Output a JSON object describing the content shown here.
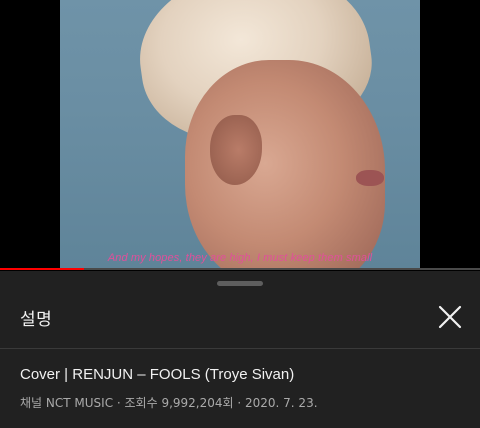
{
  "video": {
    "subtitle": "And my hopes, they are high, I must keep them small",
    "progress": 0.175,
    "progress_color": "#ff0000"
  },
  "sheet": {
    "title": "설명",
    "close_icon": "close-icon",
    "video_title": "Cover | RENJUN – FOOLS (Troye Sivan)",
    "meta": "채널 NCT MUSIC · 조회수 9,992,204회 · 2020. 7. 23."
  }
}
